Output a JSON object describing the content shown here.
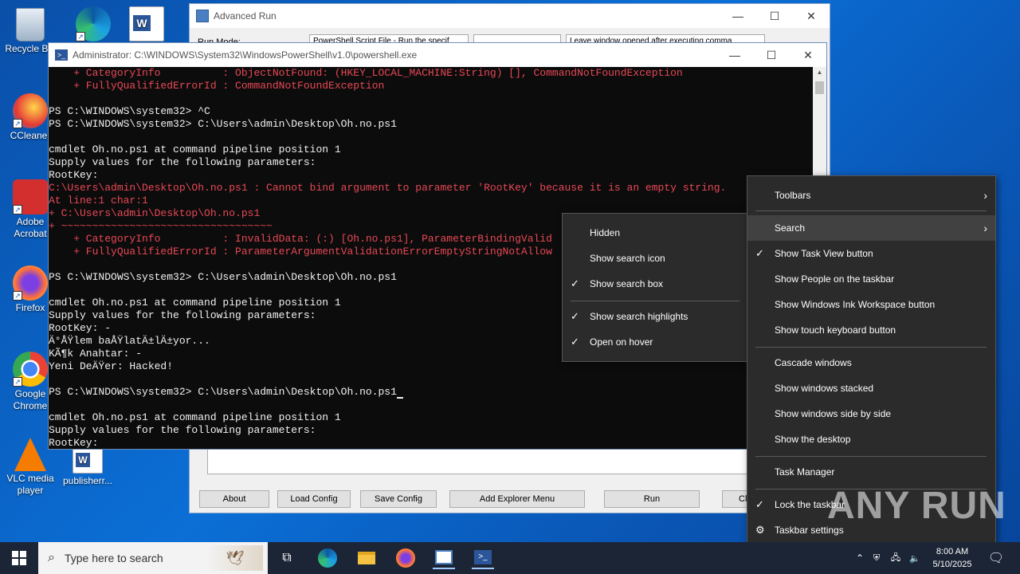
{
  "desktop_icons": [
    {
      "id": "recycle",
      "label": "Recycle Bin",
      "icon": "recycle-bin-icon"
    },
    {
      "id": "edge",
      "label": "",
      "icon": "edge-icon"
    },
    {
      "id": "word-top",
      "label": "",
      "icon": "word-icon"
    },
    {
      "id": "ccleaner",
      "label": "CCleaner",
      "icon": "ccleaner-icon"
    },
    {
      "id": "acrobat",
      "label": "Adobe Acrobat",
      "icon": "acrobat-icon"
    },
    {
      "id": "firefox",
      "label": "Firefox",
      "icon": "firefox-icon"
    },
    {
      "id": "chrome",
      "label": "Google Chrome",
      "icon": "chrome-icon"
    },
    {
      "id": "vlc",
      "label": "VLC media player",
      "icon": "vlc-icon"
    },
    {
      "id": "publisher",
      "label": "publisherr...",
      "icon": "word-doc-icon"
    }
  ],
  "advanced_run": {
    "title": "Advanced Run",
    "run_mode_label": "Run Mode:",
    "run_mode_value": "PowerShell Script File - Run the specif",
    "window_option_value": "Leave window opened after executing comma",
    "buttons": {
      "about": "About",
      "load": "Load Config",
      "save": "Save Config",
      "explorer": "Add Explorer Menu",
      "run": "Run",
      "close": "Cl"
    }
  },
  "powershell": {
    "title": "Administrator: C:\\WINDOWS\\System32\\WindowsPowerShell\\v1.0\\powershell.exe",
    "lines": [
      {
        "c": "r",
        "t": "    + CategoryInfo          : ObjectNotFound: (HKEY_LOCAL_MACHINE:String) [], CommandNotFoundException"
      },
      {
        "c": "r",
        "t": "    + FullyQualifiedErrorId : CommandNotFoundException"
      },
      {
        "c": "w",
        "t": ""
      },
      {
        "c": "w",
        "t": "PS C:\\WINDOWS\\system32> ^C"
      },
      {
        "c": "w",
        "t": "PS C:\\WINDOWS\\system32> C:\\Users\\admin\\Desktop\\Oh.no.ps1"
      },
      {
        "c": "w",
        "t": ""
      },
      {
        "c": "w",
        "t": "cmdlet Oh.no.ps1 at command pipeline position 1"
      },
      {
        "c": "w",
        "t": "Supply values for the following parameters:"
      },
      {
        "c": "w",
        "t": "RootKey:"
      },
      {
        "c": "r",
        "t": "C:\\Users\\admin\\Desktop\\Oh.no.ps1 : Cannot bind argument to parameter 'RootKey' because it is an empty string."
      },
      {
        "c": "r",
        "t": "At line:1 char:1"
      },
      {
        "c": "r",
        "t": "+ C:\\Users\\admin\\Desktop\\Oh.no.ps1"
      },
      {
        "c": "r",
        "t": "+ ~~~~~~~~~~~~~~~~~~~~~~~~~~~~~~~~~~"
      },
      {
        "c": "r",
        "t": "    + CategoryInfo          : InvalidData: (:) [Oh.no.ps1], ParameterBindingValid"
      },
      {
        "c": "r",
        "t": "    + FullyQualifiedErrorId : ParameterArgumentValidationErrorEmptyStringNotAllow"
      },
      {
        "c": "w",
        "t": ""
      },
      {
        "c": "w",
        "t": "PS C:\\WINDOWS\\system32> C:\\Users\\admin\\Desktop\\Oh.no.ps1"
      },
      {
        "c": "w",
        "t": ""
      },
      {
        "c": "w",
        "t": "cmdlet Oh.no.ps1 at command pipeline position 1"
      },
      {
        "c": "w",
        "t": "Supply values for the following parameters:"
      },
      {
        "c": "w",
        "t": "RootKey: -"
      },
      {
        "c": "w",
        "t": "Ä°ÅŸlem baÅŸlatÄ±lÄ±yor..."
      },
      {
        "c": "w",
        "t": "KÃ¶k Anahtar: -"
      },
      {
        "c": "w",
        "t": "Yeni DeÄŸer: Hacked!"
      },
      {
        "c": "w",
        "t": ""
      },
      {
        "c": "w",
        "t": "PS C:\\WINDOWS\\system32> C:\\Users\\admin\\Desktop\\Oh.no.ps1"
      },
      {
        "c": "w",
        "t": ""
      },
      {
        "c": "w",
        "t": "cmdlet Oh.no.ps1 at command pipeline position 1"
      },
      {
        "c": "w",
        "t": "Supply values for the following parameters:"
      },
      {
        "c": "w",
        "t": "RootKey:"
      }
    ]
  },
  "search_submenu": {
    "items": [
      {
        "label": "Hidden",
        "checked": false
      },
      {
        "label": "Show search icon",
        "checked": false
      },
      {
        "label": "Show search box",
        "checked": true
      },
      {
        "label": "Show search highlights",
        "checked": true
      },
      {
        "label": "Open on hover",
        "checked": true
      }
    ]
  },
  "taskbar_menu": {
    "items": [
      {
        "label": "Toolbars",
        "submenu": true
      },
      {
        "label": "Search",
        "submenu": true,
        "highlighted": true
      },
      {
        "label": "Show Task View button",
        "checked": true
      },
      {
        "label": "Show People on the taskbar"
      },
      {
        "label": "Show Windows Ink Workspace button"
      },
      {
        "label": "Show touch keyboard button"
      },
      {
        "label": "Cascade windows"
      },
      {
        "label": "Show windows stacked"
      },
      {
        "label": "Show windows side by side"
      },
      {
        "label": "Show the desktop"
      },
      {
        "label": "Task Manager"
      },
      {
        "label": "Lock the taskbar",
        "checked": true
      },
      {
        "label": "Taskbar settings",
        "gear": true
      }
    ]
  },
  "taskbar": {
    "search_placeholder": "Type here to search",
    "time": "8:00 AM",
    "date": "5/10/2025"
  },
  "watermark": "ANY RUN"
}
